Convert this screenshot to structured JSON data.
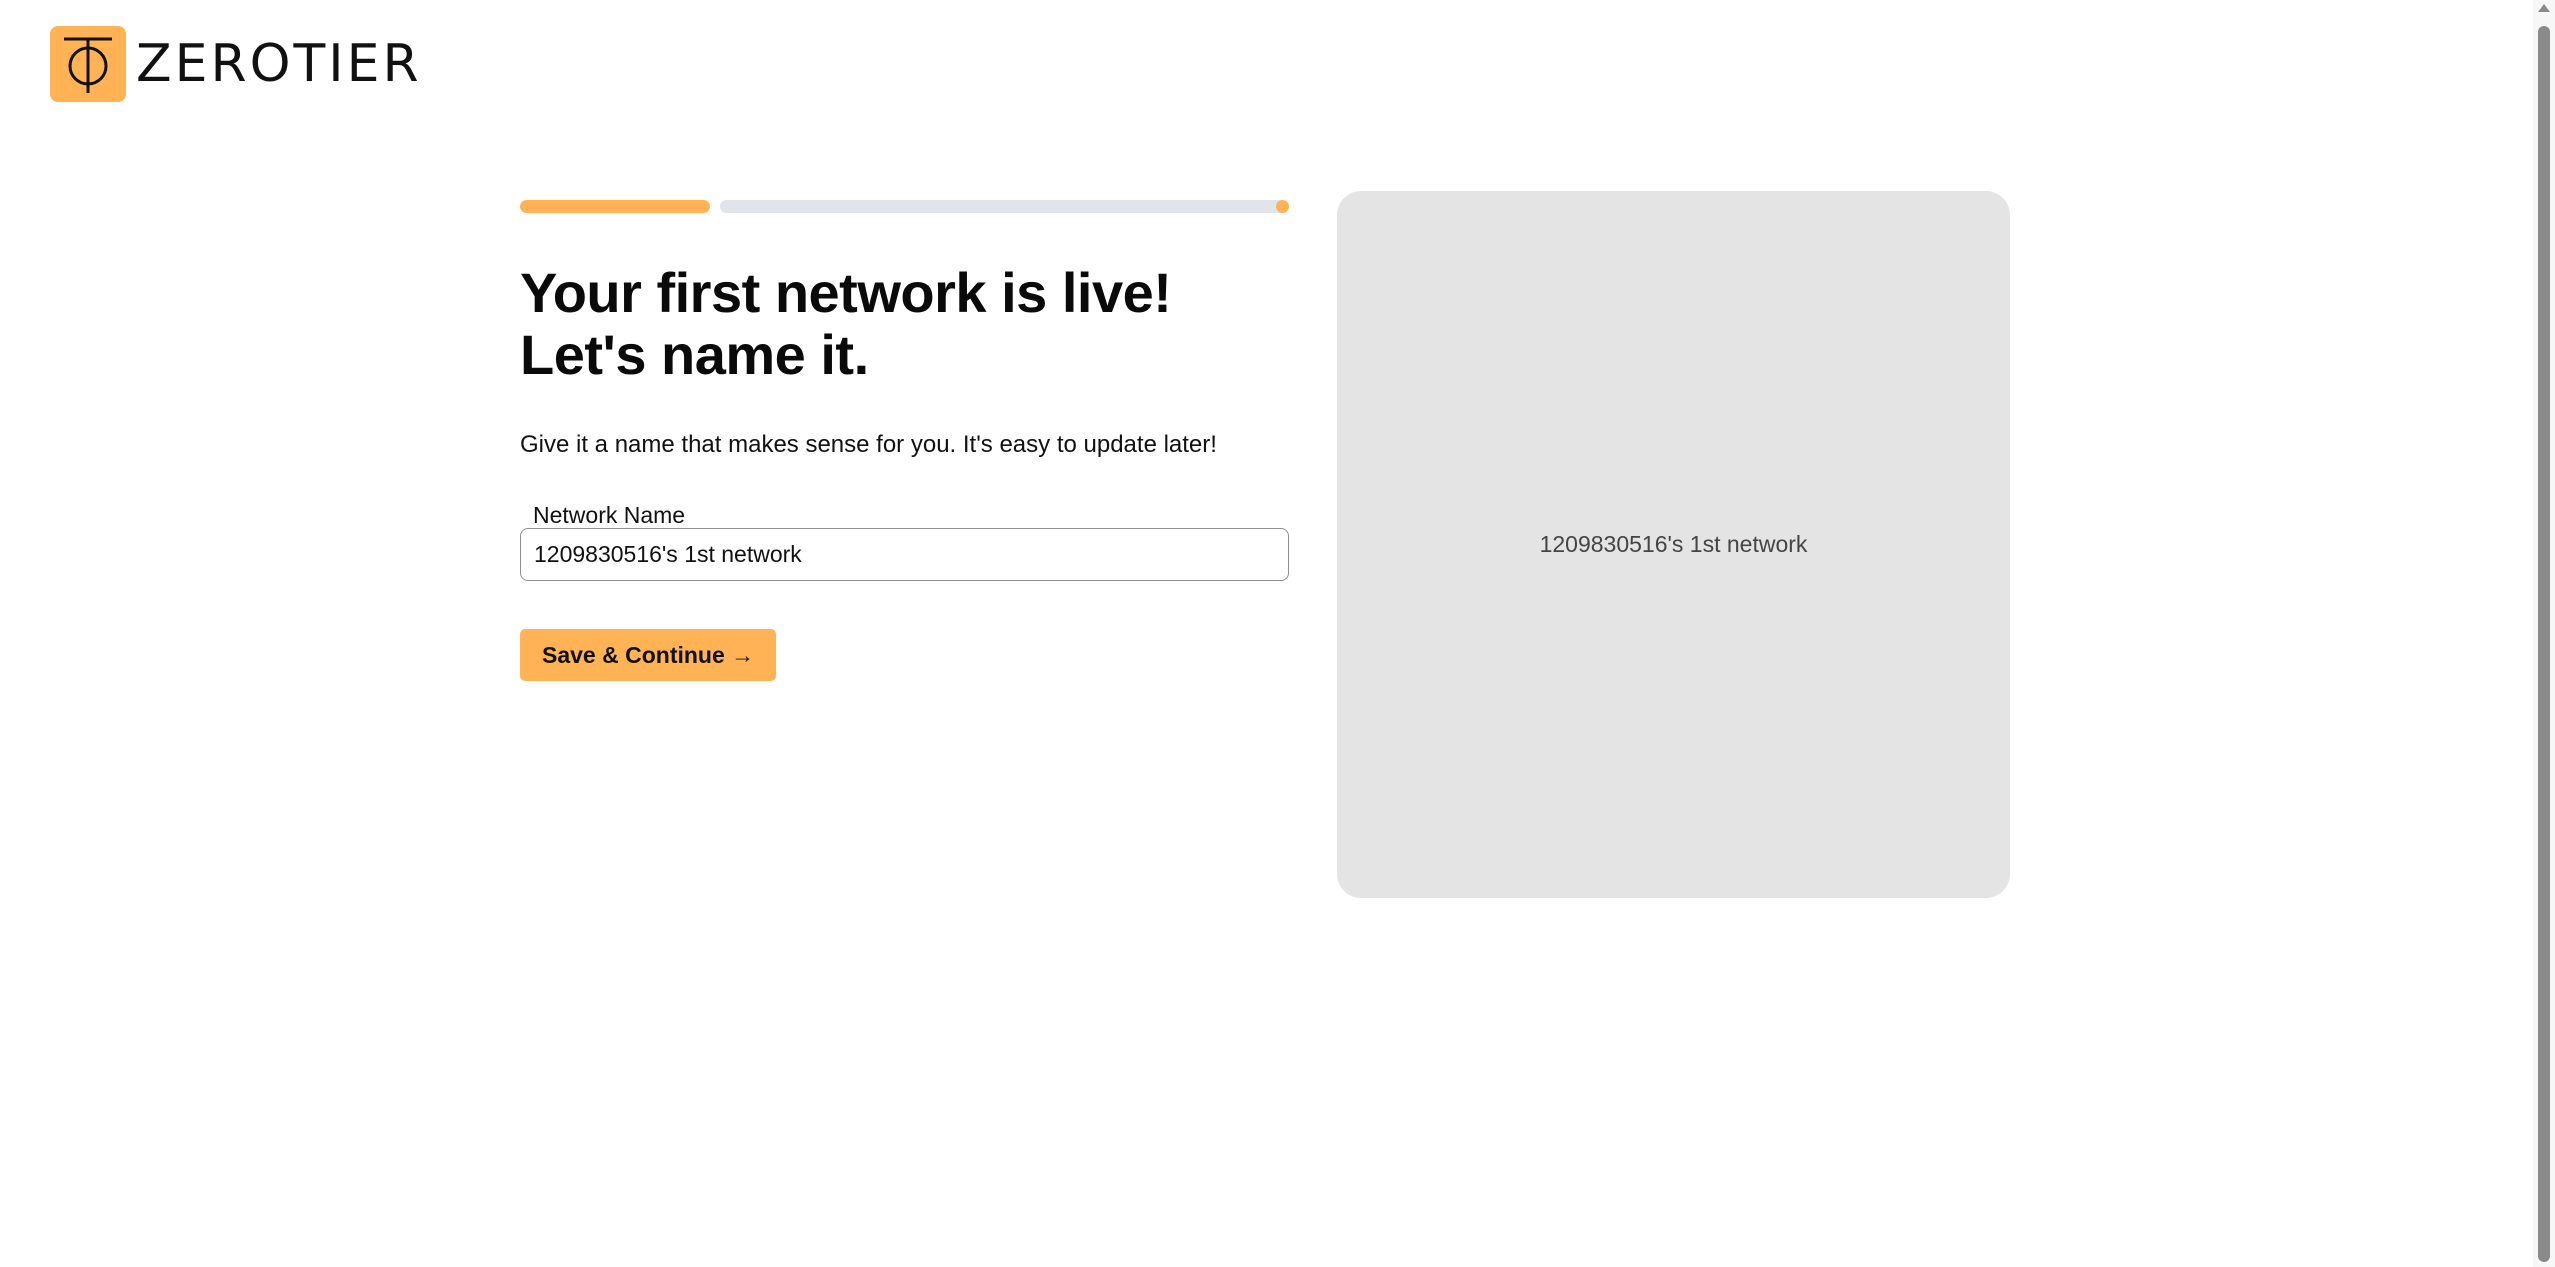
{
  "brand": {
    "name": "ZEROTIER",
    "accent_color": "#ffb354",
    "logo_icon": "zerotier-logo-icon"
  },
  "progress": {
    "completed_fraction": 0.25
  },
  "main": {
    "heading": "Your first network is live! Let's name it.",
    "subtext": "Give it a name that makes sense for you. It's easy to update later!",
    "field": {
      "label": "Network Name",
      "value": "1209830516's 1st network"
    },
    "save_label": "Save & Continue →"
  },
  "preview": {
    "network_name": "1209830516's 1st network",
    "background_color": "#e4e4e4"
  }
}
